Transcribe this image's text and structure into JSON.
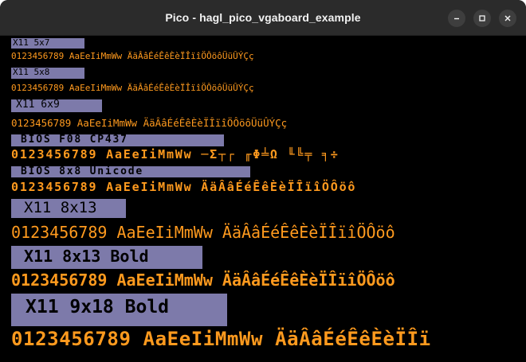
{
  "window": {
    "title": "Pico - hagl_pico_vgaboard_example",
    "controls": {
      "minimize_icon": "minimize-icon",
      "maximize_icon": "maximize-icon",
      "close_icon": "close-icon"
    }
  },
  "colors": {
    "label_bg": "#7d7aaa",
    "sample_fg": "#ff9a1e",
    "background": "#000000",
    "titlebar": "#2b2b2b"
  },
  "fonts": [
    {
      "label": "X11 5x7",
      "sample": "0123456789 AaEeIiMmWw ÄäÂâÉéÊêÈèÏÎïîÖÔöôÜüÛÝÇç"
    },
    {
      "label": "X11 5x8",
      "sample": "0123456789 AaEeIiMmWw ÄäÂâÉéÊêÈèÏÎïîÖÔöôÜüÛÝÇç"
    },
    {
      "label": "X11 6x9",
      "sample": "0123456789 AaEeIiMmWw ÄäÂâÉéÊêÈèÏÎïîÖÔöôÜüÛÝÇç"
    },
    {
      "label": "BIOS F08 CP437",
      "sample": "0123456789 AaEeIiMmWw ─Σ┬┌ ╓Φ╧Ω ╙╚╤ ╕÷"
    },
    {
      "label": "BIOS 8x8 Unicode",
      "sample": "0123456789 AaEeIiMmWw ÄäÂâÉéÊêÈèÏÎïîÖÔöô"
    },
    {
      "label": "X11 8x13",
      "sample": "0123456789 AaEeIiMmWw ÄäÂâÉéÊêÈèÏÎïîÖÔöô"
    },
    {
      "label": "X11 8x13 Bold",
      "sample": "0123456789 AaEeIiMmWw ÄäÂâÉéÊêÈèÏÎïîÖÔöô"
    },
    {
      "label": "X11 9x18 Bold",
      "sample": "0123456789 AaEeIiMmWw ÄäÂâÉéÊêÈèÏÎï"
    }
  ]
}
